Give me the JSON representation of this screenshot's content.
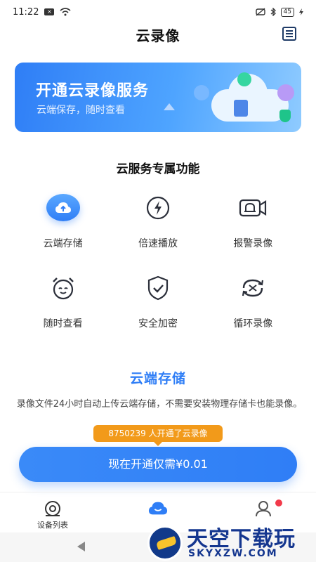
{
  "status_bar": {
    "time": "11:22",
    "battery": "45"
  },
  "header": {
    "title": "云录像"
  },
  "banner": {
    "title": "开通云录像服务",
    "subtitle": "云端保存，随时查看"
  },
  "features": {
    "title": "云服务专属功能",
    "items": [
      {
        "label": "云端存储",
        "icon": "cloud-upload-icon",
        "active": true
      },
      {
        "label": "倍速播放",
        "icon": "speed-icon"
      },
      {
        "label": "报警录像",
        "icon": "alarm-camera-icon"
      },
      {
        "label": "随时查看",
        "icon": "clock-icon"
      },
      {
        "label": "安全加密",
        "icon": "shield-check-icon"
      },
      {
        "label": "循环录像",
        "icon": "loop-icon"
      }
    ]
  },
  "detail": {
    "title": "云端存储",
    "description": "录像文件24小时自动上传云端存储，不需要安装物理存储卡也能录像。"
  },
  "promo": {
    "tooltip": "8750239 人开通了云录像",
    "cta": "现在开通仅需¥0.01"
  },
  "tabbar": {
    "items": [
      {
        "label": "设备列表"
      },
      {
        "label": ""
      },
      {
        "label": ""
      }
    ]
  },
  "watermark": {
    "cn": "天空下载玩",
    "en": "SKYXZW.COM"
  },
  "colors": {
    "accent": "#2f7ef6",
    "tooltip": "#f29a1a"
  }
}
